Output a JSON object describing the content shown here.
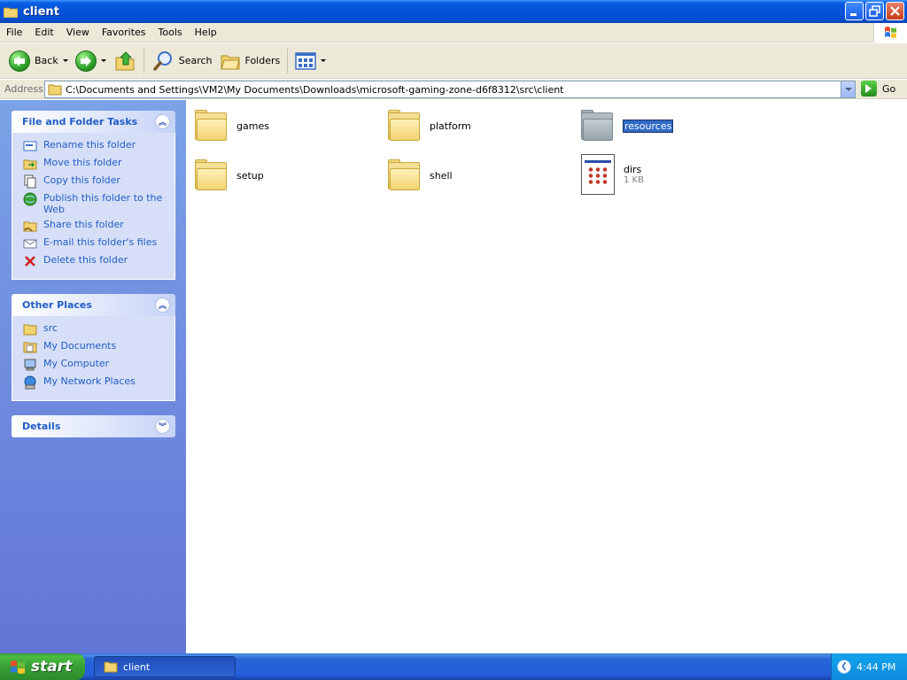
{
  "window": {
    "title": "client"
  },
  "menu": [
    "File",
    "Edit",
    "View",
    "Favorites",
    "Tools",
    "Help"
  ],
  "toolbar": {
    "back_label": "Back",
    "search_label": "Search",
    "folders_label": "Folders"
  },
  "address": {
    "label": "Address",
    "value": "C:\\Documents and Settings\\VM2\\My Documents\\Downloads\\microsoft-gaming-zone-d6f8312\\src\\client",
    "go_label": "Go"
  },
  "tasks_panel": {
    "title": "File and Folder Tasks",
    "items": [
      {
        "label": "Rename this folder",
        "icon": "rename-icon"
      },
      {
        "label": "Move this folder",
        "icon": "move-icon"
      },
      {
        "label": "Copy this folder",
        "icon": "copy-icon"
      },
      {
        "label": "Publish this folder to the Web",
        "icon": "publish-web-icon"
      },
      {
        "label": "Share this folder",
        "icon": "share-icon"
      },
      {
        "label": "E-mail this folder's files",
        "icon": "email-icon"
      },
      {
        "label": "Delete this folder",
        "icon": "delete-icon"
      }
    ]
  },
  "places_panel": {
    "title": "Other Places",
    "items": [
      {
        "label": "src",
        "icon": "folder-icon"
      },
      {
        "label": "My Documents",
        "icon": "my-documents-icon"
      },
      {
        "label": "My Computer",
        "icon": "my-computer-icon"
      },
      {
        "label": "My Network Places",
        "icon": "network-places-icon"
      }
    ]
  },
  "details_panel": {
    "title": "Details"
  },
  "files": [
    {
      "name": "games",
      "type": "folder"
    },
    {
      "name": "platform",
      "type": "folder"
    },
    {
      "name": "resources",
      "type": "folder",
      "selected": true
    },
    {
      "name": "setup",
      "type": "folder"
    },
    {
      "name": "shell",
      "type": "folder"
    },
    {
      "name": "dirs",
      "type": "file",
      "size": "1 KB"
    }
  ],
  "taskbar": {
    "start_label": "start",
    "task_label": "client",
    "clock": "4:44 PM"
  },
  "colors": {
    "title_blue": "#0354d8",
    "link_blue": "#215dc6",
    "selection": "#316ac5",
    "start_green": "#37a135"
  }
}
